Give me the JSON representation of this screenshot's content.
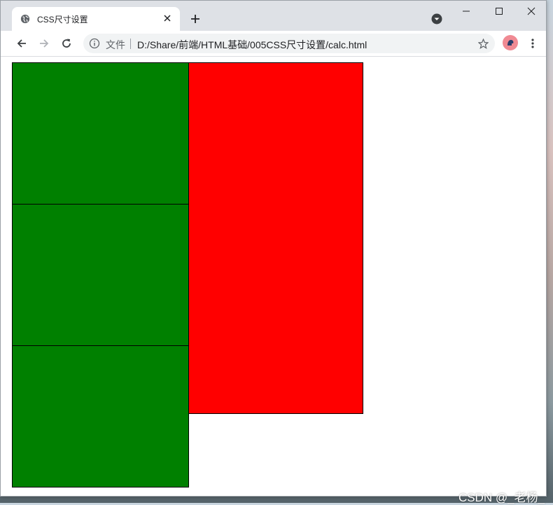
{
  "tab": {
    "title": "CSS尺寸设置"
  },
  "address_bar": {
    "scheme_label": "文件",
    "url": "D:/Share/前端/HTML基础/005CSS尺寸设置/calc.html"
  },
  "page": {
    "colors": {
      "green_box": "#008000",
      "red_box": "#ff0000",
      "border": "#000000"
    }
  },
  "icons": [
    "globe-icon",
    "close-icon",
    "plus-icon",
    "tab-search-icon",
    "minimize-icon",
    "maximize-icon",
    "close-window-icon",
    "back-arrow-icon",
    "forward-arrow-icon",
    "reload-icon",
    "info-icon",
    "star-icon",
    "avatar-icon",
    "more-menu-icon"
  ],
  "watermark": "CSDN @_老杨_"
}
